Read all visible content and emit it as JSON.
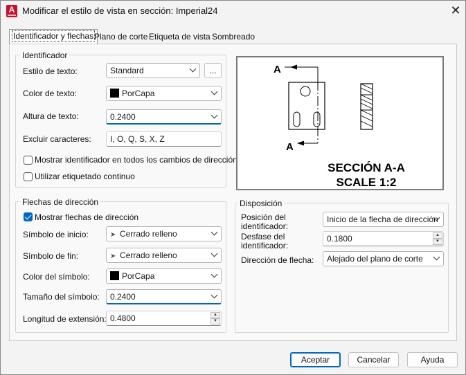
{
  "window": {
    "title": "Modificar el estilo de vista en sección: Imperial24",
    "close_glyph": "✕",
    "app_icon_letter": "A"
  },
  "tabs": [
    {
      "label": "Identificador y flechas",
      "active": true
    },
    {
      "label": "Plano de corte",
      "active": false
    },
    {
      "label": "Etiqueta de vista",
      "active": false
    },
    {
      "label": "Sombreado",
      "active": false
    }
  ],
  "identificador": {
    "group_title": "Identificador",
    "text_style_label": "Estilo de texto:",
    "text_style_value": "Standard",
    "browse_label": "...",
    "text_color_label": "Color de texto:",
    "text_color_value": "PorCapa",
    "text_height_label": "Altura de texto:",
    "text_height_value": "0.2400",
    "exclude_label": "Excluir caracteres:",
    "exclude_value": "I, O, Q, S, X, Z",
    "show_all_label": "Mostrar identificador en todos los cambios de dirección",
    "show_all_checked": false,
    "continuous_label": "Utilizar etiquetado continuo",
    "continuous_checked": false
  },
  "flechas": {
    "group_title": "Flechas de dirección",
    "show_arrows_label": "Mostrar flechas de dirección",
    "show_arrows_checked": true,
    "start_symbol_label": "Símbolo de inicio:",
    "start_symbol_value": "Cerrado relleno",
    "end_symbol_label": "Símbolo de fin:",
    "end_symbol_value": "Cerrado relleno",
    "symbol_color_label": "Color del símbolo:",
    "symbol_color_value": "PorCapa",
    "symbol_size_label": "Tamaño del símbolo:",
    "symbol_size_value": "0.2400",
    "extension_label": "Longitud de extensión:",
    "extension_value": "0.4800"
  },
  "preview": {
    "label_top": "A",
    "label_bottom": "A",
    "section_title": "SECCIÓN A-A",
    "scale_text": "SCALE 1:2"
  },
  "disposicion": {
    "group_title": "Disposición",
    "position_label": "Posición del identificador:",
    "position_value": "Inicio de la flecha de dirección",
    "offset_label": "Desfase del identificador:",
    "offset_value": "0.1800",
    "arrow_direction_label": "Dirección de flecha:",
    "arrow_direction_value": "Alejado del plano de corte"
  },
  "buttons": {
    "ok": "Aceptar",
    "cancel": "Cancelar",
    "help": "Ayuda"
  },
  "colors": {
    "accent": "#0067c0",
    "app_icon": "#c8102e",
    "swatch": "#000000"
  }
}
